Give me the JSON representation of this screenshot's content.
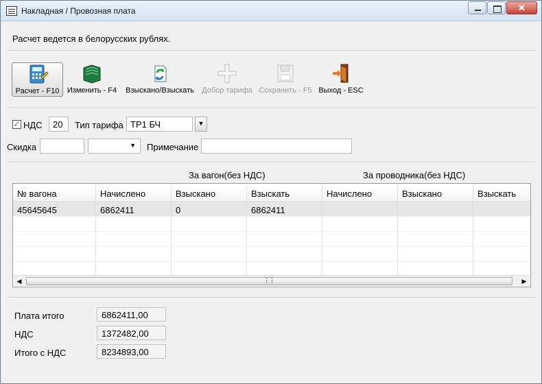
{
  "window": {
    "title": "Накладная / Провозная плата"
  },
  "info": "Расчет ведется в белорусских рублях.",
  "toolbar": [
    {
      "label": "Расчет - F10",
      "icon": "calculator-icon"
    },
    {
      "label": "Изменить - F4",
      "icon": "ledger-edit-icon"
    },
    {
      "label": "Взыскано/Взыскать",
      "icon": "refresh-document-icon"
    },
    {
      "label": "Добор тарифа",
      "icon": "plus-icon"
    },
    {
      "label": "Сохранить - F5",
      "icon": "save-icon"
    },
    {
      "label": "Выход - ESC",
      "icon": "exit-door-icon"
    }
  ],
  "form": {
    "vat_label": "НДС",
    "vat_value": "20",
    "tariff_label": "Тип тарифа",
    "tariff_value": "ТР1 БЧ",
    "discount_label": "Скидка",
    "discount_value": "",
    "discount_select": "",
    "note_label": "Примечание",
    "note_value": ""
  },
  "section_headers": {
    "wagon": "За вагон(без НДС)",
    "conductor": "За проводника(без НДС)"
  },
  "table": {
    "columns": [
      "№ вагона",
      "Начислено",
      "Взыскано",
      "Взыскать",
      "Начислено",
      "Взыскано",
      "Взыскать"
    ],
    "rows": [
      [
        "45645645",
        "6862411",
        "0",
        "6862411",
        "",
        "",
        ""
      ]
    ]
  },
  "totals": [
    {
      "label": "Плата итого",
      "value": "6862411,00"
    },
    {
      "label": "НДС",
      "value": "1372482,00"
    },
    {
      "label": "Итого с НДС",
      "value": "8234893,00"
    }
  ]
}
